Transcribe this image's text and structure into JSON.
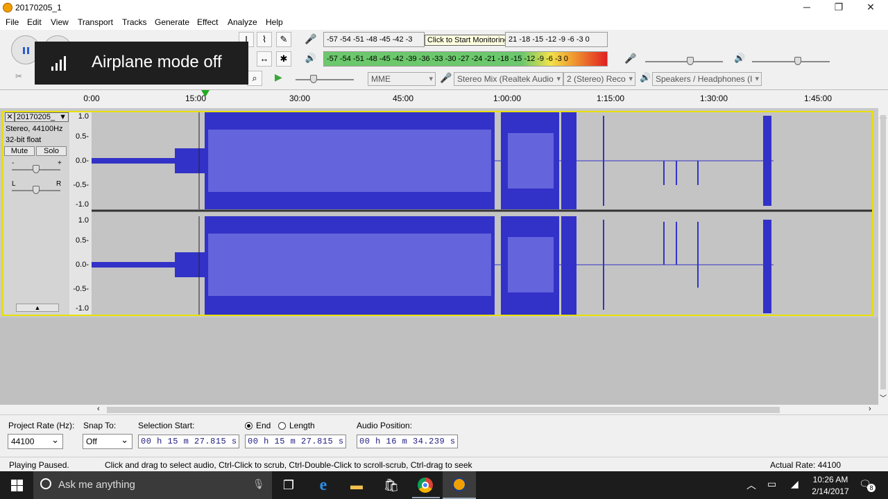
{
  "window": {
    "title": "20170205_1",
    "controls": [
      "─",
      "❐",
      "✕"
    ]
  },
  "menu": [
    "File",
    "Edit",
    "View",
    "Transport",
    "Tracks",
    "Generate",
    "Effect",
    "Analyze",
    "Help"
  ],
  "meters": {
    "record_scale": "-57 -54 -51 -48 -45 -42 -3",
    "record_scale_tail": "21 -18 -15 -12  -9  -6  -3  0",
    "tooltip": "Click to Start Monitoring",
    "play_scale": "-57 -54 -51 -48 -45 -42 -39 -36 -33 -30 -27 -24 -21 -18 -15 -12  -9  -6  -3  0"
  },
  "device_toolbar": {
    "host": "MME",
    "recording_device": "Stereo Mix (Realtek Audio",
    "channels": "2 (Stereo) Reco",
    "playback_device": "Speakers / Headphones (I"
  },
  "toast": {
    "message": "Airplane mode off"
  },
  "ruler": {
    "ticks": [
      "0:00",
      "15:00",
      "30:00",
      "45:00",
      "1:00:00",
      "1:15:00",
      "1:30:00",
      "1:45:00"
    ]
  },
  "track": {
    "name": "20170205_",
    "format": "Stereo, 44100Hz",
    "bit_depth": "32-bit float",
    "mute_label": "Mute",
    "solo_label": "Solo",
    "gain_minus": "-",
    "gain_plus": "+",
    "pan_left": "L",
    "pan_right": "R",
    "scale_labels": [
      "1.0",
      "0.5-",
      "0.0-",
      "-0.5-",
      "-1.0"
    ]
  },
  "selection_bar": {
    "project_rate_label": "Project Rate (Hz):",
    "project_rate": "44100",
    "snap_to_label": "Snap To:",
    "snap_to": "Off",
    "selection_start_label": "Selection Start:",
    "selection_start": "00 h 15 m 27.815 s",
    "end_label": "End",
    "length_label": "Length",
    "selection_end": "00 h 15 m 27.815 s",
    "audio_position_label": "Audio Position:",
    "audio_position": "00 h 16 m 34.239 s"
  },
  "status": {
    "state": "Playing Paused.",
    "hint": "Click and drag to select audio, Ctrl-Click to scrub, Ctrl-Double-Click to scroll-scrub, Ctrl-drag to seek",
    "actual_rate": "Actual Rate: 44100"
  },
  "taskbar": {
    "search_placeholder": "Ask me anything",
    "time": "10:26 AM",
    "date": "2/14/2017",
    "notification_count": "8"
  },
  "colors": {
    "waveform": "#3232c8",
    "waveform_rms": "#6464dc",
    "track_border": "#e8e000",
    "playhead": "#22aa22"
  }
}
